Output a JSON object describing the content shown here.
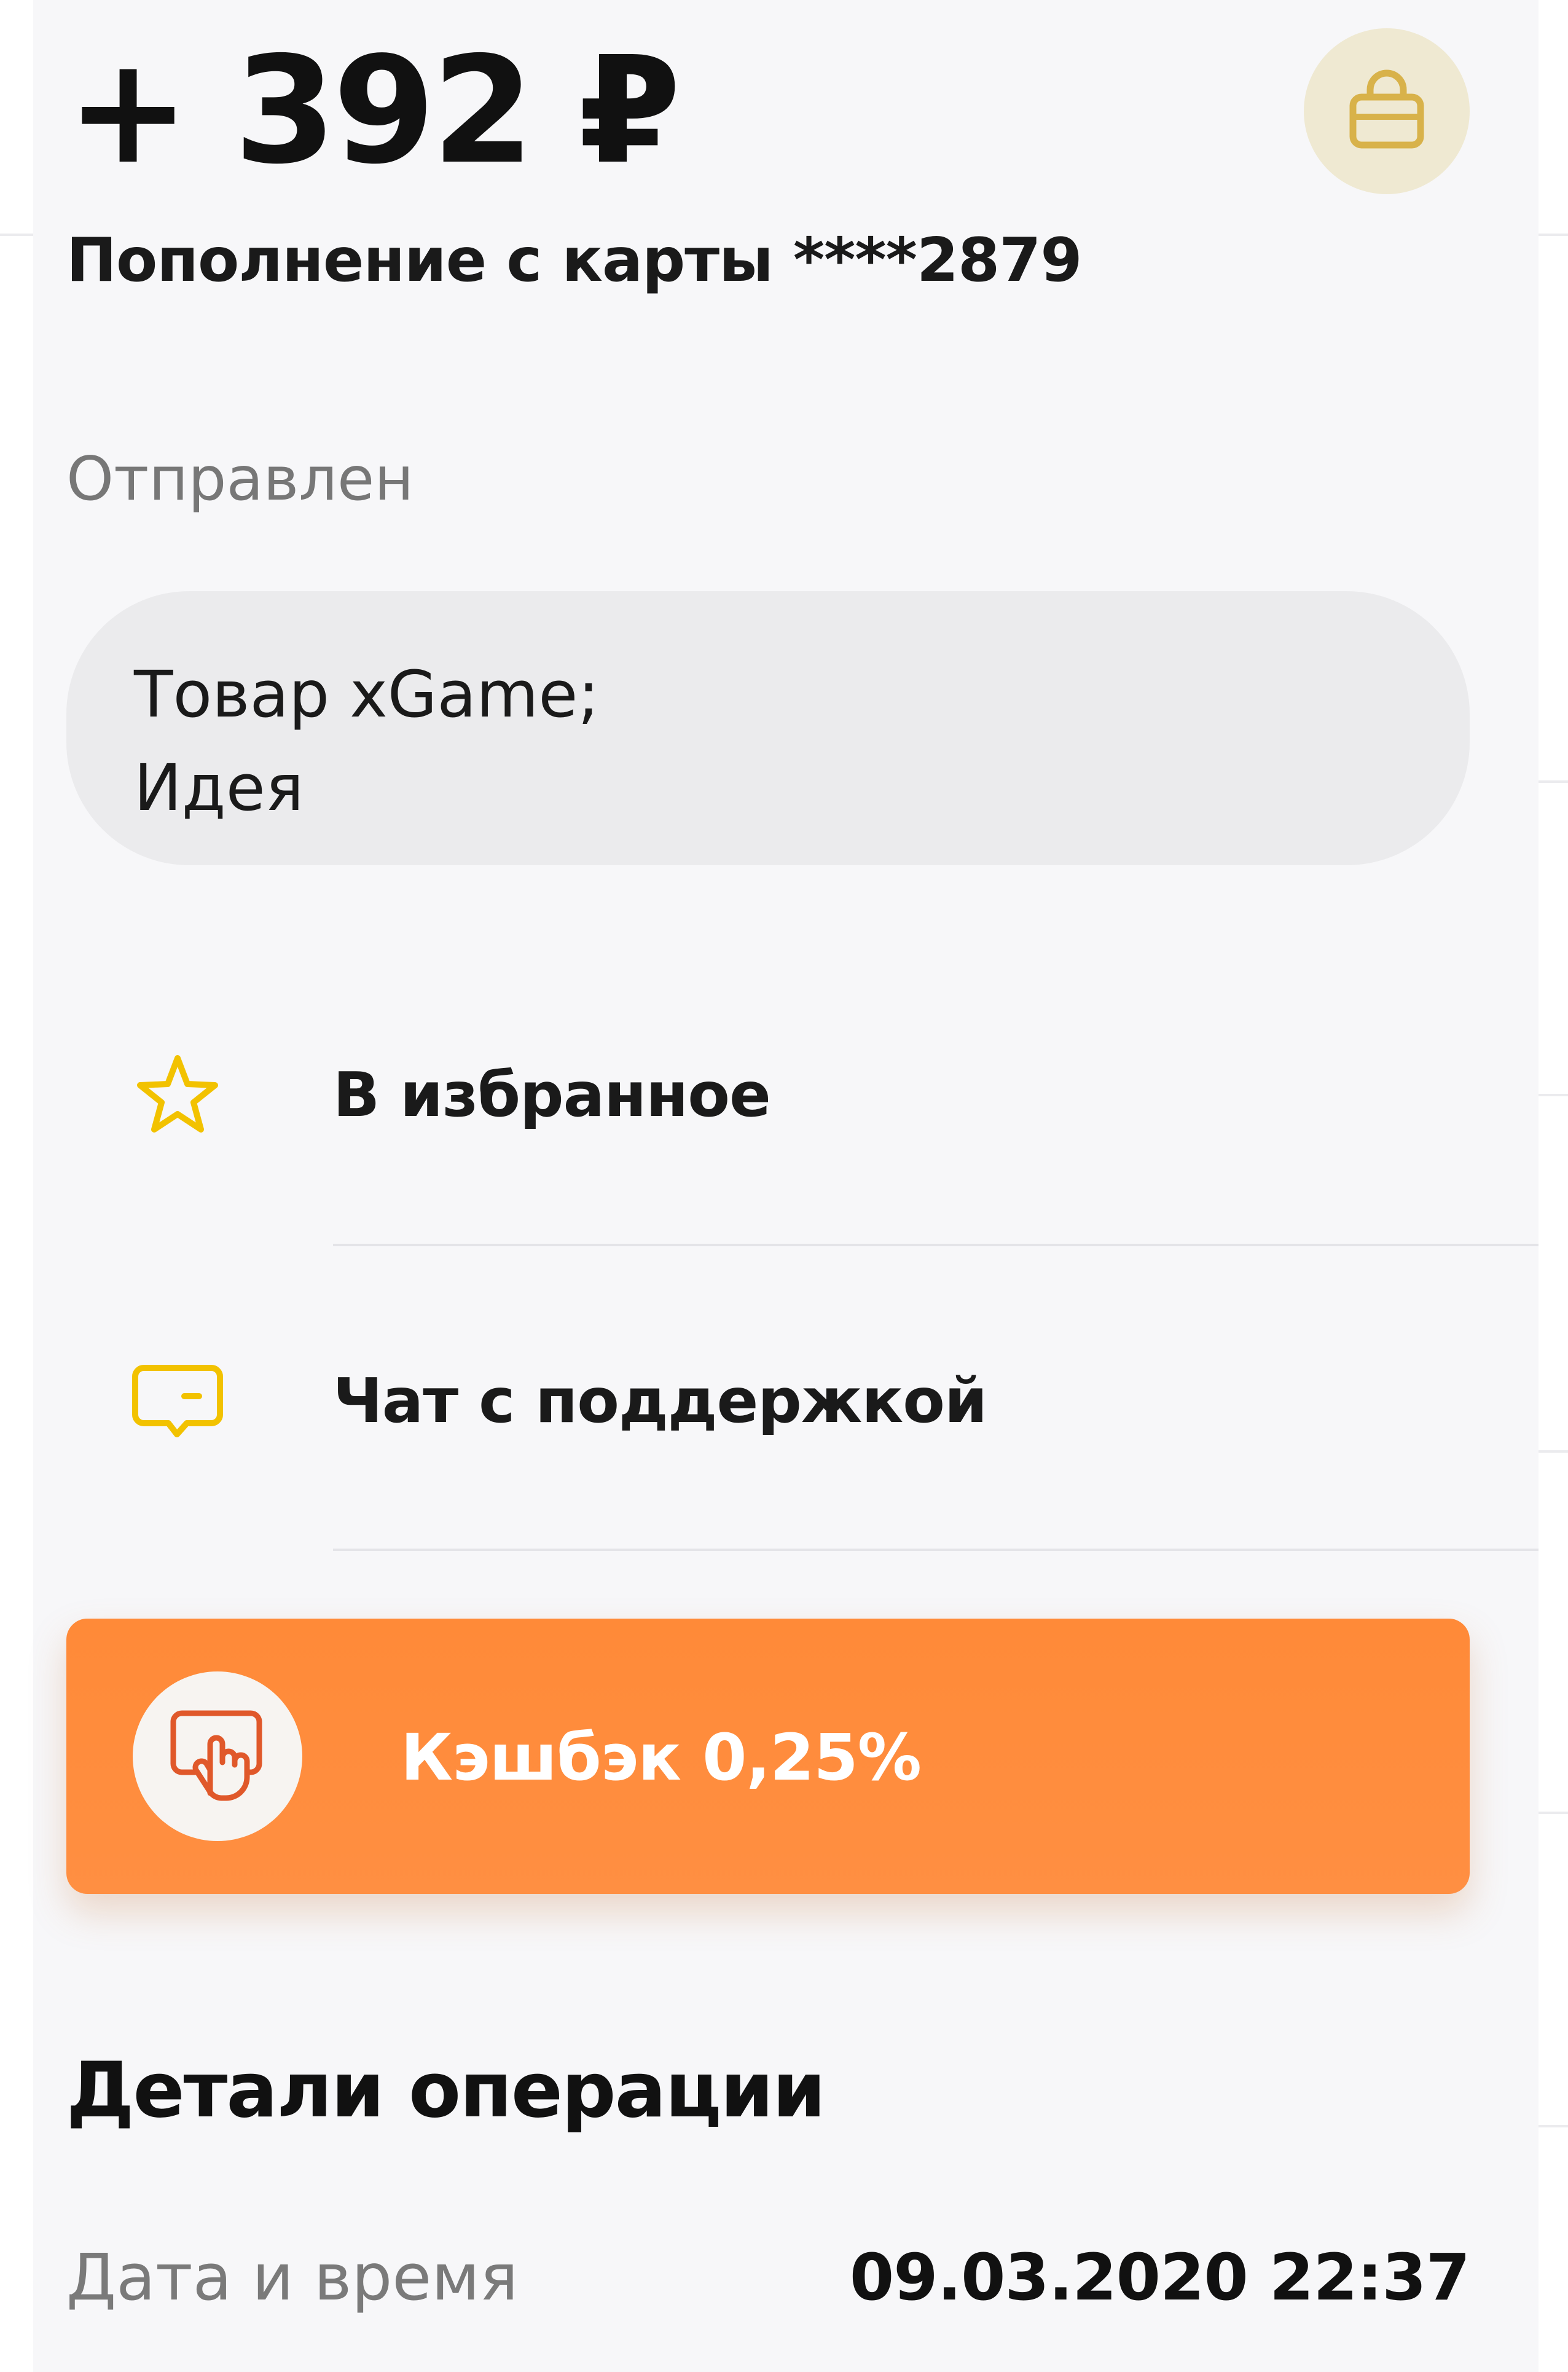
{
  "transaction": {
    "amount": "+ 392 ₽",
    "subtitle": "Пополнение с карты ****2879",
    "status": "Отправлен",
    "message_lines": [
      "Товар xGame;",
      "Идея"
    ]
  },
  "actions": {
    "favorite_label": "В избранное",
    "support_label": "Чат с поддержкой"
  },
  "cashback": {
    "label": "Кэшбэк 0,25%"
  },
  "details": {
    "title": "Детали операции",
    "datetime_label": "Дата и время",
    "datetime_value": "09.03.2020 22:37"
  },
  "icons": {
    "bag": "shopping-bag-icon",
    "favorite": "star-icon",
    "support": "chat-bubble-icon",
    "cashback": "hand-pointer-icon"
  },
  "colors": {
    "accent_yellow": "#f2c200",
    "cashback_orange": "#ff8a38",
    "cashback_icon": "#e0582a",
    "bag_circle": "#efe9d2",
    "bag_icon": "#d8b24a"
  }
}
